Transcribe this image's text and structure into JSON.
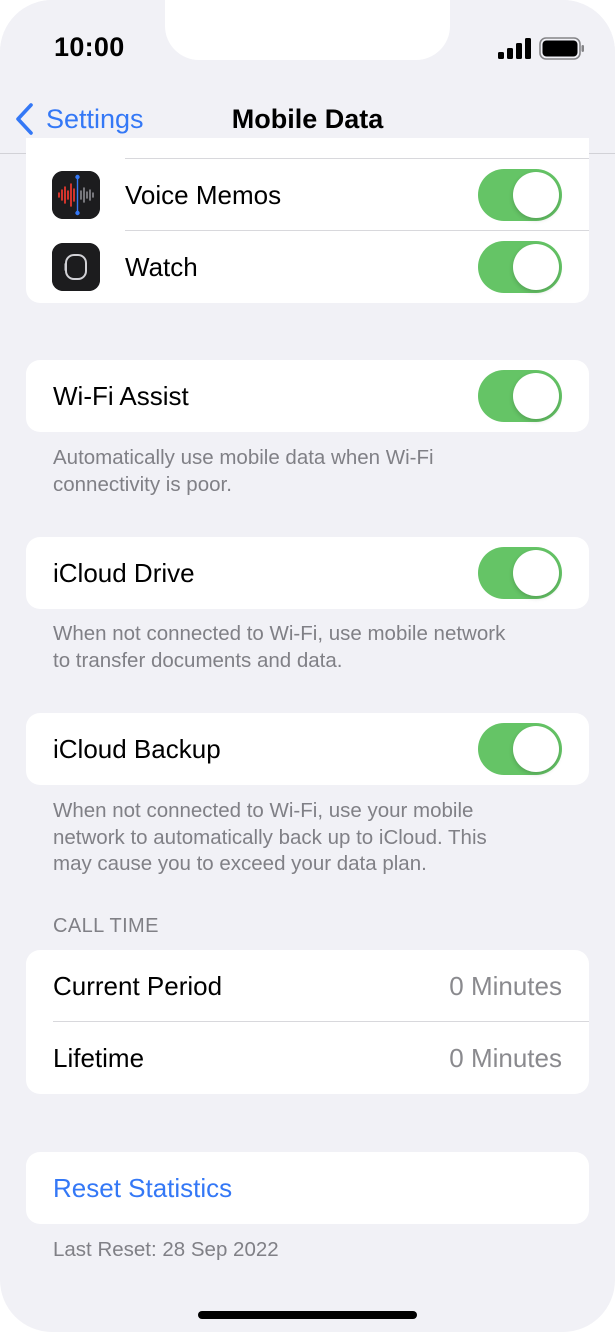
{
  "status_bar": {
    "time": "10:00",
    "signal_icon": "cellular-signal-icon",
    "battery_icon": "battery-full-icon"
  },
  "nav": {
    "back_label": "Settings",
    "title": "Mobile Data"
  },
  "apps": [
    {
      "label": "Voice Memos",
      "icon": "voice-memos-icon",
      "enabled": true
    },
    {
      "label": "Watch",
      "icon": "watch-icon",
      "enabled": true
    }
  ],
  "wifi_assist": {
    "label": "Wi-Fi Assist",
    "enabled": true,
    "footnote_line1": "Automatically use mobile data when Wi-Fi",
    "footnote_line2": "connectivity is poor."
  },
  "icloud_drive": {
    "label": "iCloud Drive",
    "enabled": true,
    "footnote_line1": "When not connected to Wi-Fi, use mobile network",
    "footnote_line2": "to transfer documents and data."
  },
  "icloud_backup": {
    "label": "iCloud Backup",
    "enabled": true,
    "footnote_line1": "When not connected to Wi-Fi, use your mobile",
    "footnote_line2": "network to automatically back up to iCloud. This",
    "footnote_line3": "may cause you to exceed your data plan."
  },
  "call_time": {
    "header": "CALL TIME",
    "rows": [
      {
        "label": "Current Period",
        "value": "0 Minutes"
      },
      {
        "label": "Lifetime",
        "value": "0 Minutes"
      }
    ]
  },
  "reset": {
    "label": "Reset Statistics",
    "last_reset": "Last Reset: 28 Sep 2022"
  },
  "colors": {
    "accent": "#3478f6",
    "toggle_on": "#65c466",
    "background": "#f1f1f6"
  }
}
